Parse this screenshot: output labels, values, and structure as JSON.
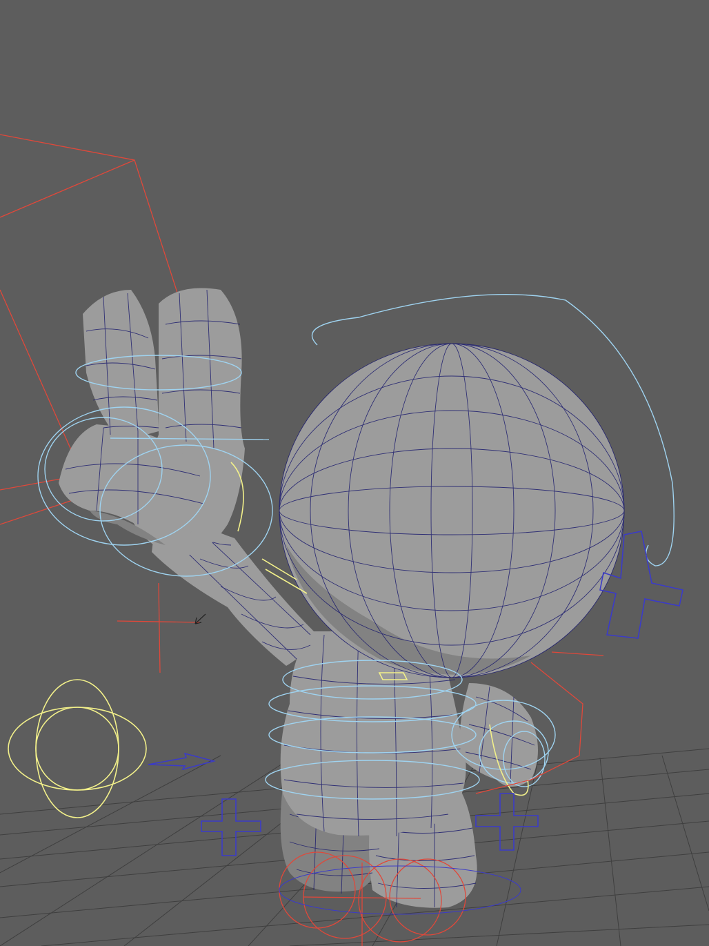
{
  "viewport": {
    "background": "#5d5d5d",
    "grid_color": "#3f3f3f",
    "mesh_color": "#9c9c9c",
    "wireframe_color": "#1c1c6e"
  },
  "controls": {
    "colors": {
      "fk_circles": "#9fd3f0",
      "ik_handles": "#f2f08a",
      "locators": "#e0483a",
      "pole_vectors": "#3b3bc8"
    }
  },
  "character": {
    "pose": "peace-sign"
  }
}
